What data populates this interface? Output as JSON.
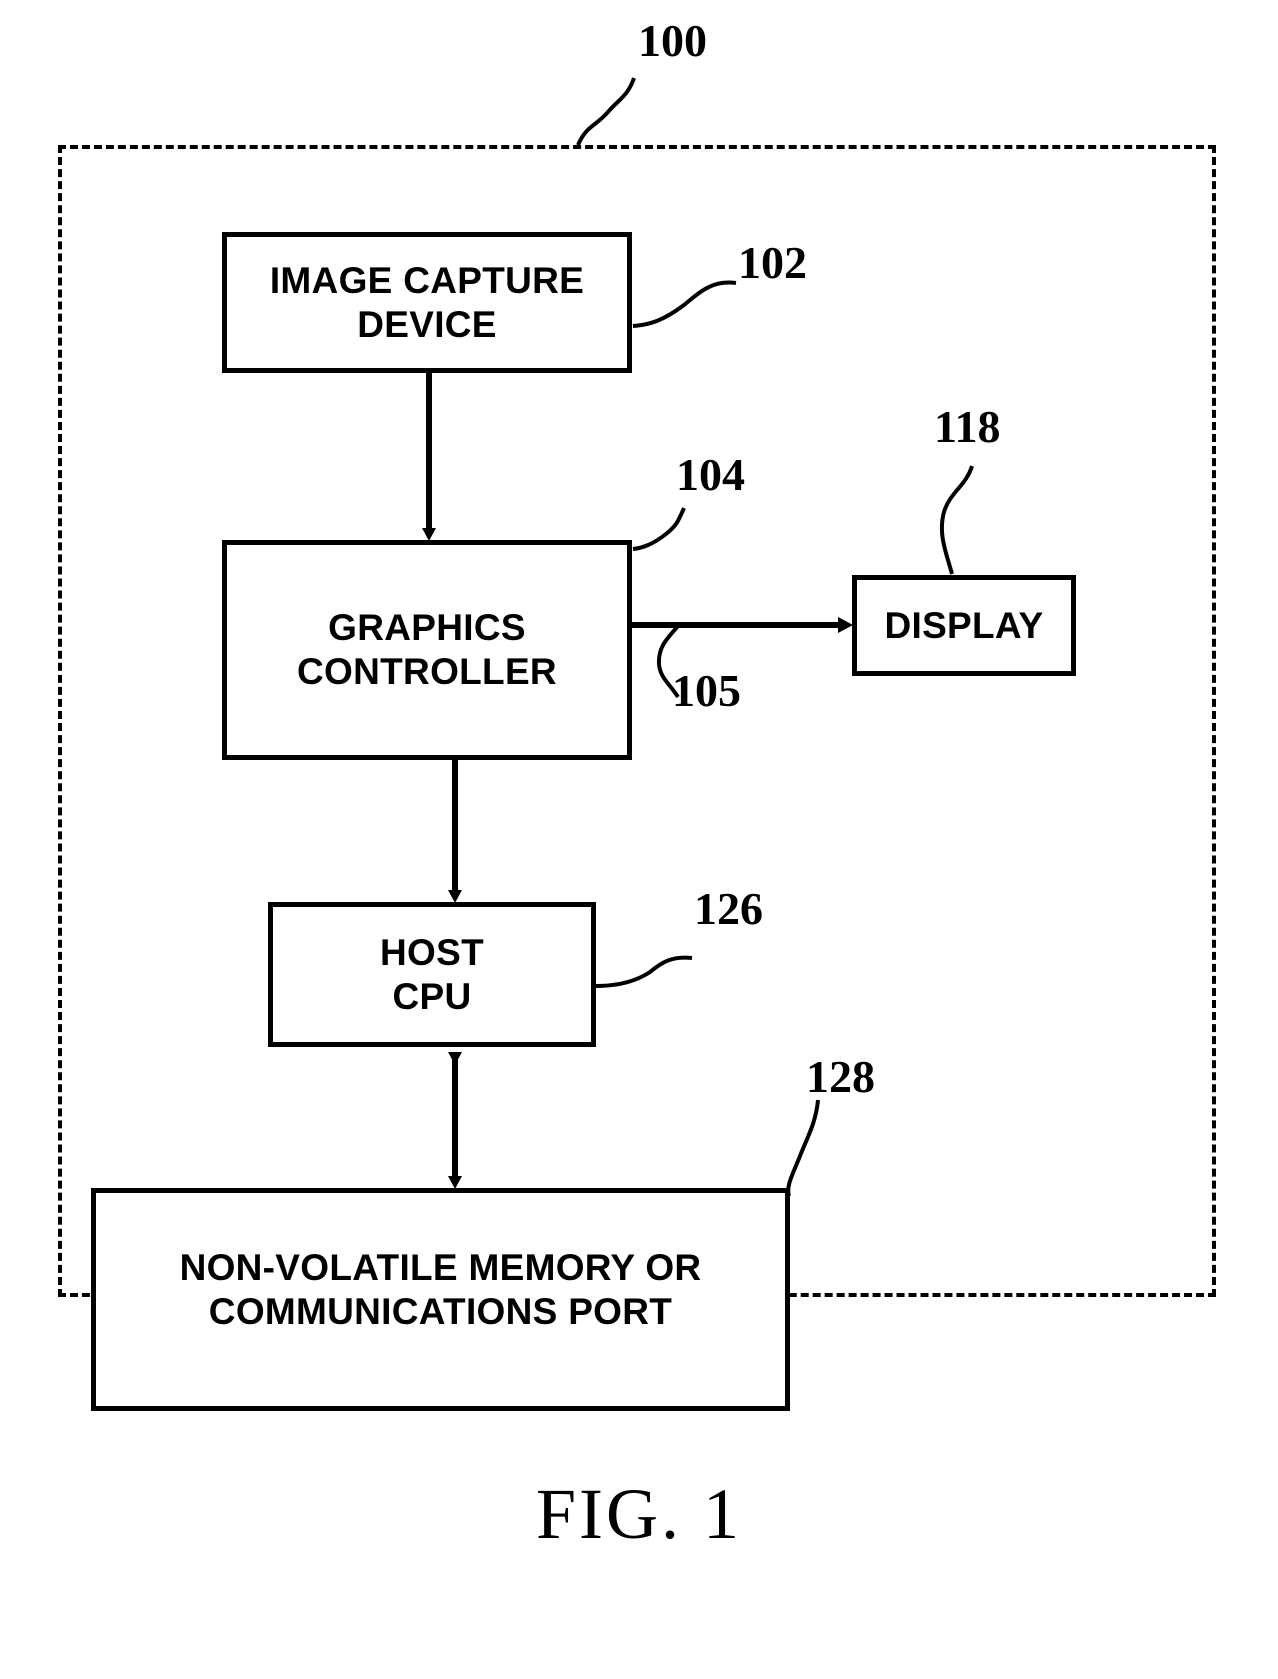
{
  "figure": {
    "caption": "FIG. 1",
    "system_reference": "100"
  },
  "blocks": [
    {
      "id": "image-capture-device",
      "label": "IMAGE CAPTURE\nDEVICE",
      "reference": "102"
    },
    {
      "id": "graphics-controller",
      "label": "GRAPHICS\nCONTROLLER",
      "reference": "104"
    },
    {
      "id": "display",
      "label": "DISPLAY",
      "reference": "118"
    },
    {
      "id": "host-cpu",
      "label": "HOST\nCPU",
      "reference": "126"
    },
    {
      "id": "non-volatile-memory",
      "label": "NON-VOLATILE MEMORY OR\nCOMMUNICATIONS PORT",
      "reference": "128"
    }
  ],
  "connectors": [
    {
      "id": "capture-to-graphics",
      "from": "image-capture-device",
      "to": "graphics-controller",
      "style": "single-arrow"
    },
    {
      "id": "graphics-to-display",
      "from": "graphics-controller",
      "to": "display",
      "style": "single-arrow",
      "reference": "105"
    },
    {
      "id": "graphics-to-host-cpu",
      "from": "graphics-controller",
      "to": "host-cpu",
      "style": "single-arrow"
    },
    {
      "id": "host-cpu-to-memory",
      "from": "host-cpu",
      "to": "non-volatile-memory",
      "style": "double-arrow"
    }
  ],
  "references": {
    "system": "100",
    "image_capture_device": "102",
    "graphics_controller": "104",
    "graphics_output_line": "105",
    "display": "118",
    "host_cpu": "126",
    "non_volatile_memory": "128"
  },
  "colors": {
    "stroke": "#000000",
    "background": "#ffffff"
  }
}
